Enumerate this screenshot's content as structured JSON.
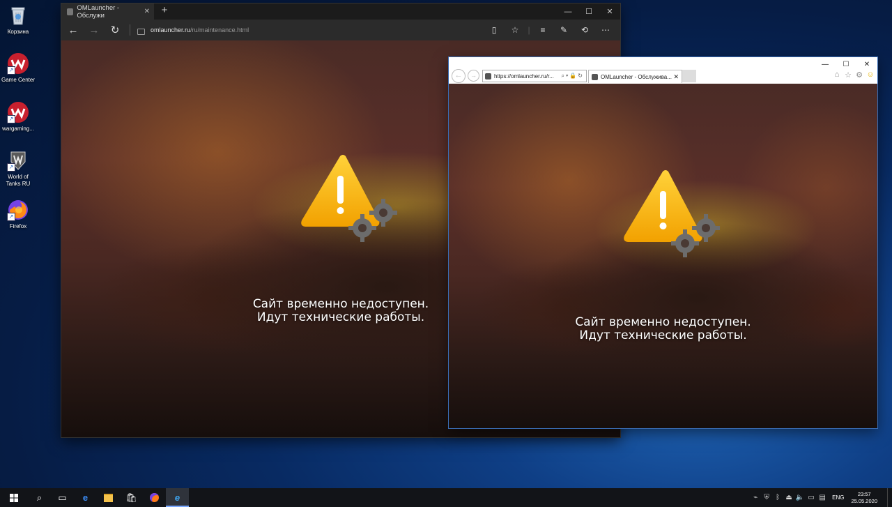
{
  "desktop": {
    "icons": [
      {
        "label": "Корзина",
        "icon": "recycle-bin-icon"
      },
      {
        "label": "Game Center",
        "icon": "wargaming-icon"
      },
      {
        "label": "wargaming...",
        "icon": "wargaming-icon"
      },
      {
        "label": "World of\nTanks RU",
        "icon": "world-of-tanks-icon"
      },
      {
        "label": "Firefox",
        "icon": "firefox-icon"
      }
    ]
  },
  "edge": {
    "tab_title": "OMLauncher - Обслужи",
    "url_domain": "omlauncher.ru",
    "url_path": "/ru/maintenance.html",
    "message_line1": "Сайт временно недоступен.",
    "message_line2": "Идут технические работы."
  },
  "ie": {
    "address": "https://omlauncher.ru/r...",
    "tab_title": "OMLauncher - Обслужива...",
    "message_line1": "Сайт временно недоступен.",
    "message_line2": "Идут технические работы."
  },
  "taskbar": {
    "lang": "ENG",
    "time": "23:57",
    "date": "25.05.2020"
  },
  "colors": {
    "warning_yellow": "#f6b80e",
    "gear_gray": "#6c6c6c",
    "taskbar": "#121418",
    "ie_accent": "#3a6db5"
  }
}
